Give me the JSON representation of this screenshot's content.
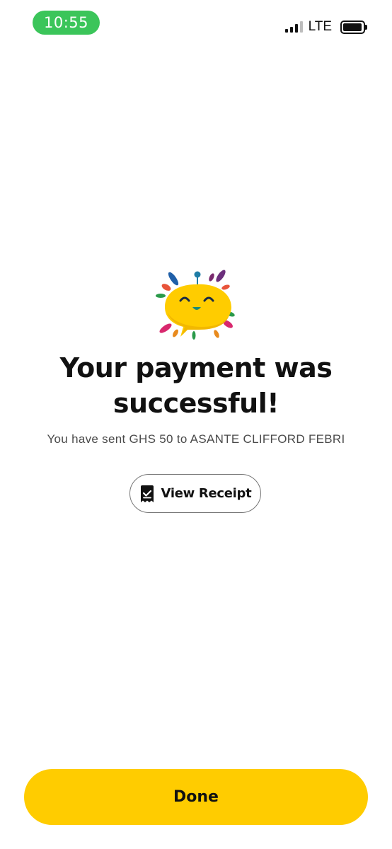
{
  "status_bar": {
    "time": "10:55",
    "network": "LTE",
    "status_pill_color": "#3bc55a"
  },
  "mascot": {
    "icon": "smiling-chat-bubble-mascot-icon",
    "color": "#ffcc00"
  },
  "result": {
    "title": "Your payment was successful!",
    "message": "You have sent GHS 50 to ASANTE CLIFFORD FEBRI"
  },
  "receipt_button": {
    "label": "View Receipt",
    "icon": "receipt-check-icon"
  },
  "done_button": {
    "label": "Done",
    "color": "#ffcc00"
  }
}
